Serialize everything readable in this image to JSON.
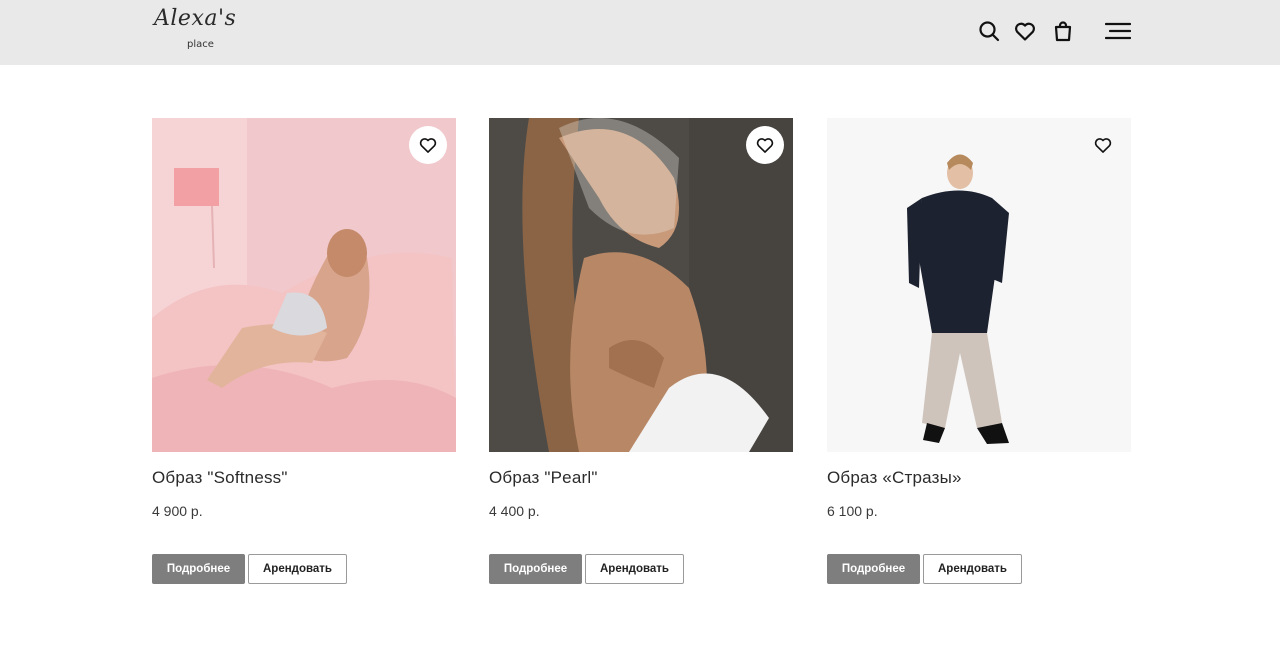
{
  "header": {
    "logo_script": "Alexa's",
    "logo_sub": "place",
    "icons": [
      "search-icon",
      "heart-icon",
      "shopping-bag-icon",
      "menu-icon"
    ]
  },
  "products": [
    {
      "title": "Образ \"Softness\"",
      "price": "4 900 р.",
      "more_label": "Подробнее",
      "rent_label": "Арендовать"
    },
    {
      "title": "Образ \"Pearl\"",
      "price": "4 400 р.",
      "more_label": "Подробнее",
      "rent_label": "Арендовать"
    },
    {
      "title": "Образ «Стразы»",
      "price": "6 100 р.",
      "more_label": "Подробнее",
      "rent_label": "Арендовать"
    }
  ],
  "colors": {
    "header_bg": "#e9e9e9",
    "primary_button": "#7e7e7e"
  }
}
